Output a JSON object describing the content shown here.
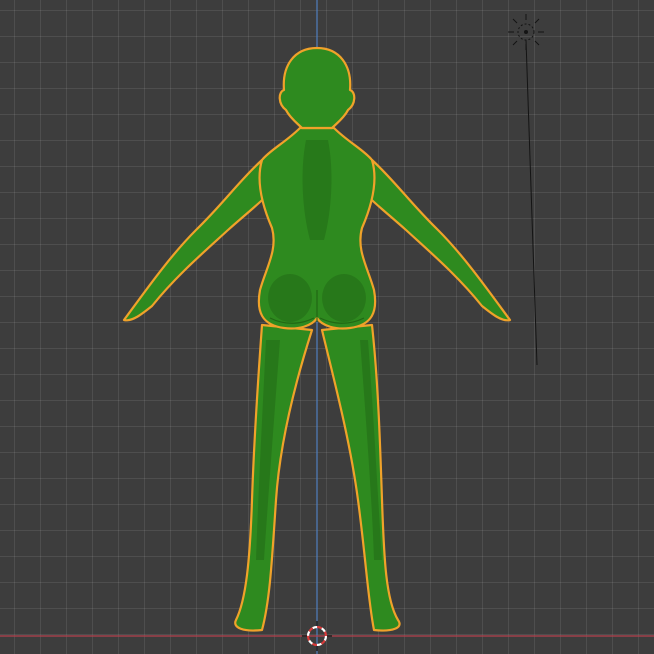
{
  "app": {
    "view": "3d-viewport",
    "mode": "object"
  },
  "colors": {
    "background": "#3d3d3d",
    "grid_line": "#4a4a4a",
    "axis_z": "#4f7fbf",
    "axis_x": "#b5414e",
    "mesh_fill": "#2e8a1f",
    "mesh_shade": "#236b16",
    "selection_outline": "#f0a22a",
    "light_gizmo": "#111111"
  },
  "scene": {
    "selected_object": {
      "kind": "character-mesh",
      "selected": true
    },
    "light": {
      "kind": "sun-light"
    },
    "cursor_3d": {
      "visible": true
    }
  }
}
